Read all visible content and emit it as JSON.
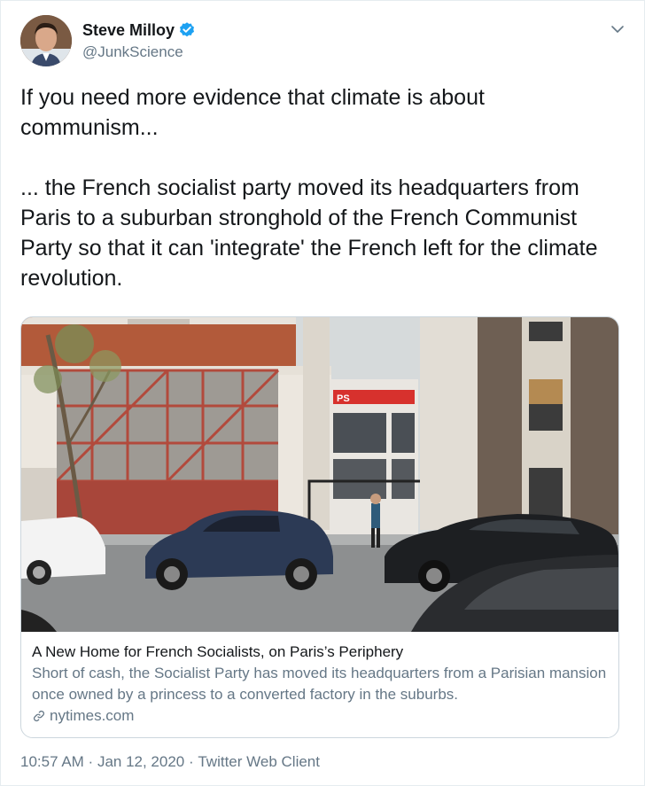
{
  "user": {
    "name": "Steve Milloy",
    "handle": "@JunkScience",
    "verified_icon": "verified-badge-icon",
    "accent": "#1da1f2"
  },
  "tweet": {
    "paragraph1": "If you need more evidence that climate is about communism...",
    "paragraph2": "... the French socialist party moved its headquarters from Paris to a suburban stronghold of the French Communist Party so that it can 'integrate' the French left for the climate revolution."
  },
  "card": {
    "title": "A New Home for French Socialists, on Paris’s Periphery",
    "description": "Short of cash, the Socialist Party has moved its headquarters from a Parisian mansion once owned by a princess to a converted factory in the suburbs.",
    "domain": "nytimes.com",
    "sign_text": "PS"
  },
  "meta": {
    "time": "10:57 AM",
    "separator": " · ",
    "date": "Jan 12, 2020",
    "client": "Twitter Web Client"
  }
}
